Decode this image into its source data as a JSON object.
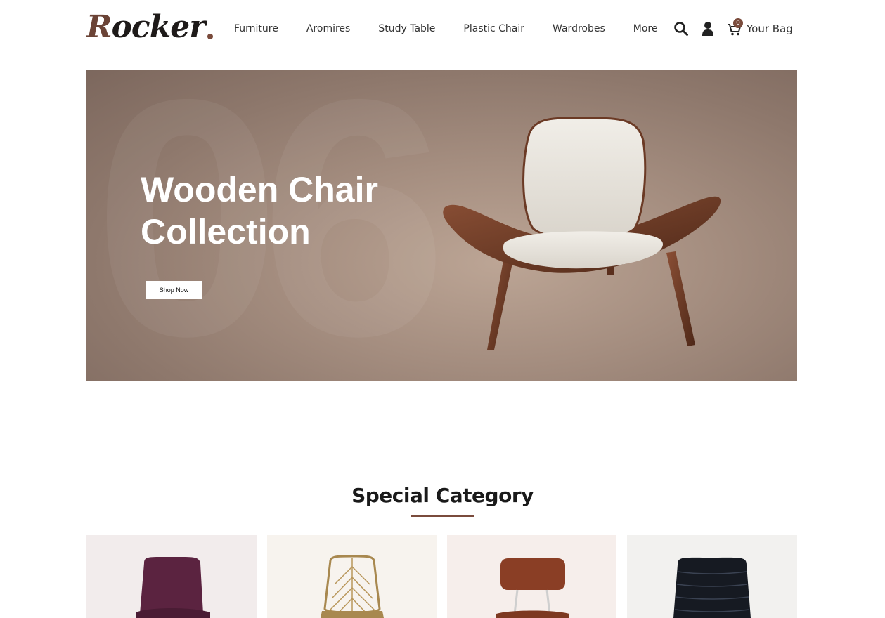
{
  "brand": {
    "logo_first": "R",
    "logo_rest": "ocker",
    "accent_color": "#7a4b3c"
  },
  "nav": {
    "items": [
      "Furniture",
      "Aromires",
      "Study Table",
      "Plastic Chair",
      "Wardrobes",
      "More"
    ]
  },
  "header_tools": {
    "search_icon": "search-icon",
    "user_icon": "user-icon",
    "cart_icon": "cart-icon",
    "bag_count": "0",
    "bag_label": "Your Bag"
  },
  "hero": {
    "title_line1": "Wooden Chair",
    "title_line2": "Collection",
    "button_label": "Shop Now",
    "watermark": "06"
  },
  "special": {
    "title": "Special Category",
    "cards": [
      {
        "chair": "purple-upholstered-chair",
        "bg": "#f2ecec"
      },
      {
        "chair": "wicker-chair",
        "bg": "#f7f3ee"
      },
      {
        "chair": "leather-metal-chair",
        "bg": "#f6eeeb"
      },
      {
        "chair": "black-leather-chair",
        "bg": "#f2f1ef"
      }
    ]
  }
}
